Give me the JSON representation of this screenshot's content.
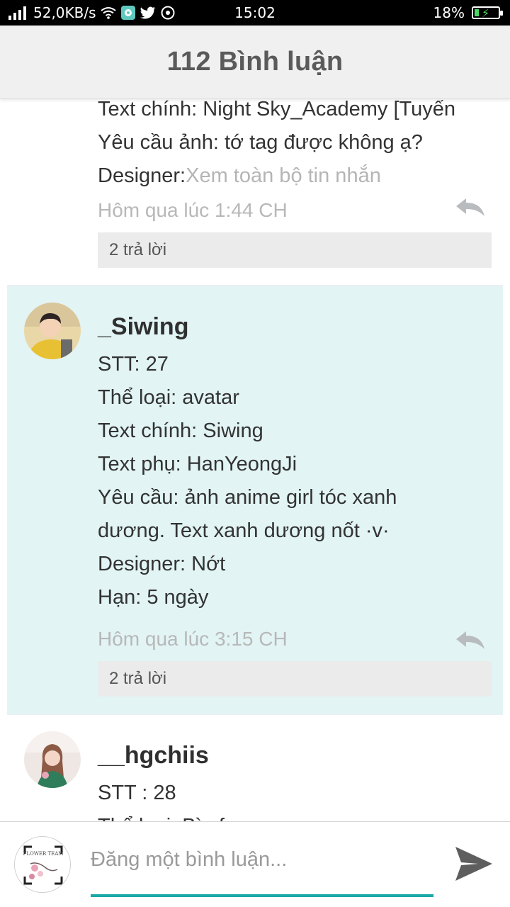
{
  "status_bar": {
    "network_speed": "52,0KB/s",
    "time": "15:02",
    "battery_percent": "18%",
    "battery_level": 0.18,
    "charging": true,
    "icons": [
      "signal-icon",
      "wifi-icon",
      "messenger-icon",
      "twitter-icon",
      "compass-icon",
      "battery-icon"
    ]
  },
  "header": {
    "title": "112 Bình luận"
  },
  "comments": [
    {
      "partial": true,
      "lines": [
        "Text chính: Night Sky_Academy [Tuyển"
      ],
      "line_request": "Yêu cầu ảnh: tớ tag được không ạ?",
      "designer_label": "Designer:",
      "see_more": "Xem toàn bộ tin nhắn",
      "timestamp": "Hôm qua lúc 1:44 CH",
      "replies": "2 trả lời"
    },
    {
      "username": "_Siwing",
      "highlighted": true,
      "lines": [
        "STT: 27",
        "Thể loại: avatar",
        "Text chính: Siwing",
        "Text phụ: HanYeongJi",
        "Yêu cầu: ảnh anime girl tóc xanh",
        "dương. Text xanh dương nốt ·v·",
        "Designer: Nớt",
        "Hạn: 5 ngày"
      ],
      "timestamp": "Hôm qua lúc 3:15 CH",
      "replies": "2 trả lời"
    },
    {
      "username": "__hgchiis",
      "lines": [
        "STT : 28",
        "Thể loại: Bìa fc"
      ]
    }
  ],
  "composer": {
    "placeholder": "Đăng một bình luận...",
    "avatar_text": "FLOWER TEAM"
  },
  "colors": {
    "highlight_bg": "#e2f4f4",
    "accent": "#1aa9a6",
    "header_bg": "#f0f0f0"
  }
}
